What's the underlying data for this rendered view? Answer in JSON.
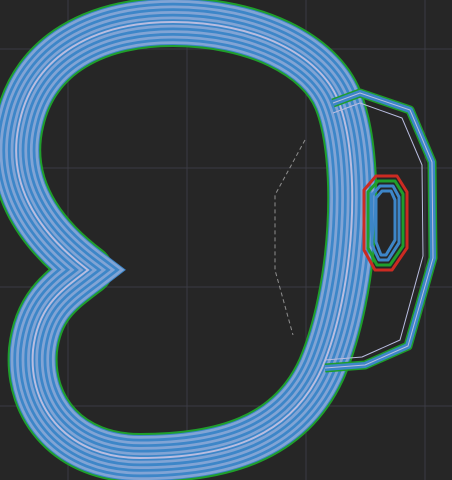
{
  "view": {
    "background_color": "#262626",
    "grid_color": "#3b3b44"
  },
  "toolpath": {
    "outer_perimeter_color": "#1f9e2c",
    "inner_perimeter_color": "#3d86c8",
    "travel_move_color": "#b9bde0",
    "seam_marker_color": "#1c1c1c",
    "hole_outer_perimeter_color": "#cc2b22",
    "outer_shell_loops": 8,
    "hole_loops": 4
  }
}
